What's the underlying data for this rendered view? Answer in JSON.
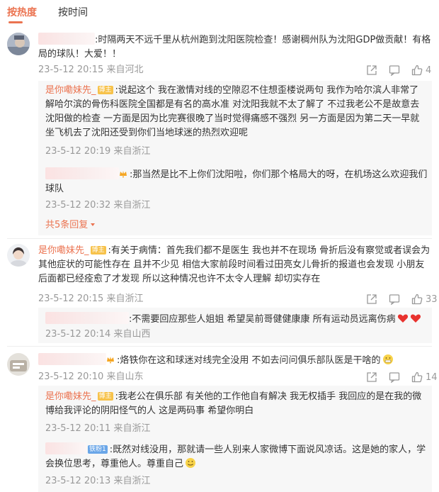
{
  "tabs": {
    "hot": "按热度",
    "time": "按时间"
  },
  "colors": {
    "accent": "#eb7350",
    "meta": "#999999",
    "text": "#333333"
  },
  "c1": {
    "text": ":时隔两天不远千里从杭州跑到沈阳医院检查！感谢稠州队为沈阳GDP做贡献！有格局的球队！大爱！！",
    "meta": "23-5-12 20:15 来自河北",
    "likes": "4",
    "replies": [
      {
        "name": "是你嘞妹先_",
        "badge": "博主",
        "text": ":说起这个 我在激情对线的空隙忍不住想歪楼说两句  我作为哈尔滨人非常了解哈尔滨的骨伤科医院全国都是有名的高水准  对沈阳我就不太了解了 不过我老公不是故意去沈阳做的检查 一方面是因为比完赛很晚了当时觉得痛感不强烈 另一方面是因为第二天一早就坐飞机去了沈阳还受到你们当地球迷的热烈欢迎呢",
        "meta": "23-5-12 20:19 来自浙江"
      },
      {
        "text": ":那当然是比不上你们沈阳啦，你们那个格局大的呀，在机场这么欢迎我们球队",
        "meta": "23-5-12 20:32 来自浙江"
      }
    ],
    "more": "共5条回复"
  },
  "c2": {
    "name": "是你嘞妹先_",
    "badge": "博主",
    "text": ":有关于病情：首先我们都不是医生 我也并不在现场 骨折后没有察觉或者误会为其他症状的可能性存在 且并不少见 相信大家前段时间看过田亮女儿骨折的报道也会发现 小朋友后面都已经痊愈了才发现 所以这种情况也许不太令人理解 却切实存在",
    "meta": "23-5-12 20:15 来自浙江",
    "likes": "33",
    "replies": [
      {
        "text": ":不需要回应那些人姐姐 希望吴前哥健健康康 所有运动员远离伤病",
        "meta": "23-5-12 20:14 来自山西"
      }
    ]
  },
  "c3": {
    "text": ":烙铁你在这和球迷对线完全没用 不如去问问俱乐部队医是干啥的",
    "meta": "23-5-12 20:10 来自山东",
    "likes": "14",
    "replies": [
      {
        "name": "是你嘞妹先_",
        "badge": "博主",
        "text": ":我老公在俱乐部 有关他的工作他自有解决 我无权插手 我回应的是在我的微博给我评论的阴阳怪气的人 这是两码事 希望你明白",
        "meta": "23-5-12 20:11 来自浙江"
      },
      {
        "badge": "铁粉1",
        "text": ":既然对线没用，那就请一些人别来人家微博下面说风凉话。这是她的家人，学会换位思考，尊重他人。尊重自己",
        "meta": "23-5-12 20:13 来自浙江"
      }
    ]
  }
}
